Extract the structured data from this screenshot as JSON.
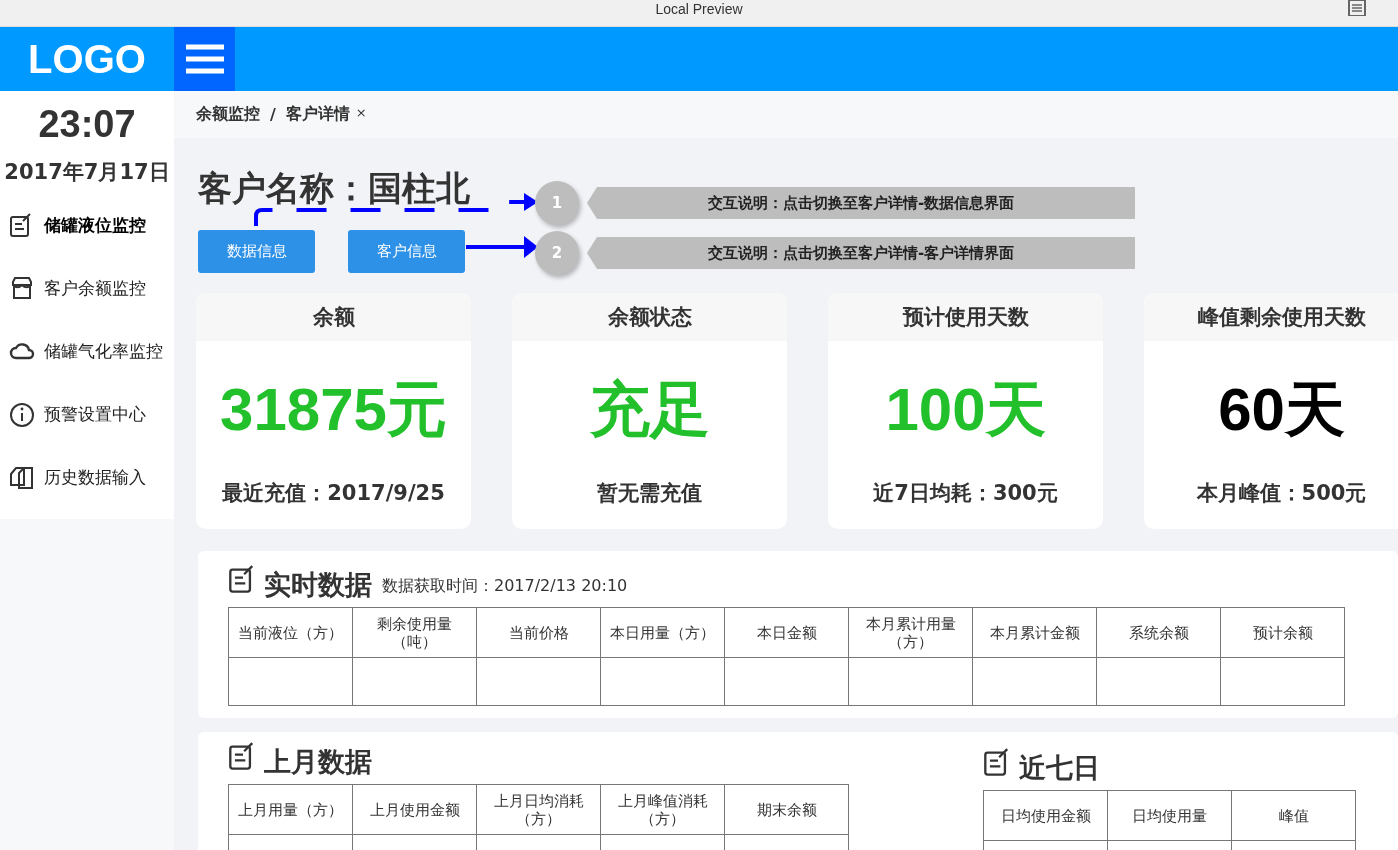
{
  "window": {
    "title": "Local Preview"
  },
  "header": {
    "logo": "LOGO"
  },
  "sidebar": {
    "time": "23:07",
    "date": "2017年7月17日",
    "items": [
      {
        "label": "储罐液位监控",
        "selected": true
      },
      {
        "label": "客户余额监控",
        "selected": false
      },
      {
        "label": "储罐气化率监控",
        "selected": false
      },
      {
        "label": "预警设置中心",
        "selected": false
      },
      {
        "label": "历史数据输入",
        "selected": false
      }
    ]
  },
  "breadcrumb": {
    "items": [
      "余额监控",
      "客户详情"
    ],
    "separator": "/",
    "close": "×"
  },
  "customer": {
    "title": "客户名称：国柱北",
    "buttons": [
      "数据信息",
      "客户信息"
    ]
  },
  "annotations": [
    {
      "number": "1",
      "text": "交互说明：点击切换至客户详情-数据信息界面"
    },
    {
      "number": "2",
      "text": "交互说明：点击切换至客户详情-客户详情界面"
    }
  ],
  "cards": [
    {
      "title": "余额",
      "value": "31875元",
      "color": "#22c02a",
      "footer": "最近充值：2017/9/25"
    },
    {
      "title": "余额状态",
      "value": "充足",
      "color": "#22c02a",
      "footer": "暂无需充值"
    },
    {
      "title": "预计使用天数",
      "value": "100天",
      "color": "#22c02a",
      "footer": "近7日均耗：300元"
    },
    {
      "title": "峰值剩余使用天数",
      "value": "60天",
      "color": "#000000",
      "footer": "本月峰值：500元"
    }
  ],
  "realtime": {
    "title": "实时数据",
    "subtitle": "数据获取时间：2017/2/13 20:10",
    "columns": [
      "当前液位（方）",
      "剩余使用量（吨）",
      "当前价格",
      "本日用量（方）",
      "本日金额",
      "本月累计用量（方）",
      "本月累计金额",
      "系统余额",
      "预计余额"
    ]
  },
  "last_month": {
    "title": "上月数据",
    "columns": [
      "上月用量（方）",
      "上月使用金额",
      "上月日均消耗（方）",
      "上月峰值消耗（方）",
      "期末余额"
    ]
  },
  "last_seven_days": {
    "title": "近七日",
    "columns": [
      "日均使用金额",
      "日均使用量",
      "峰值"
    ]
  }
}
